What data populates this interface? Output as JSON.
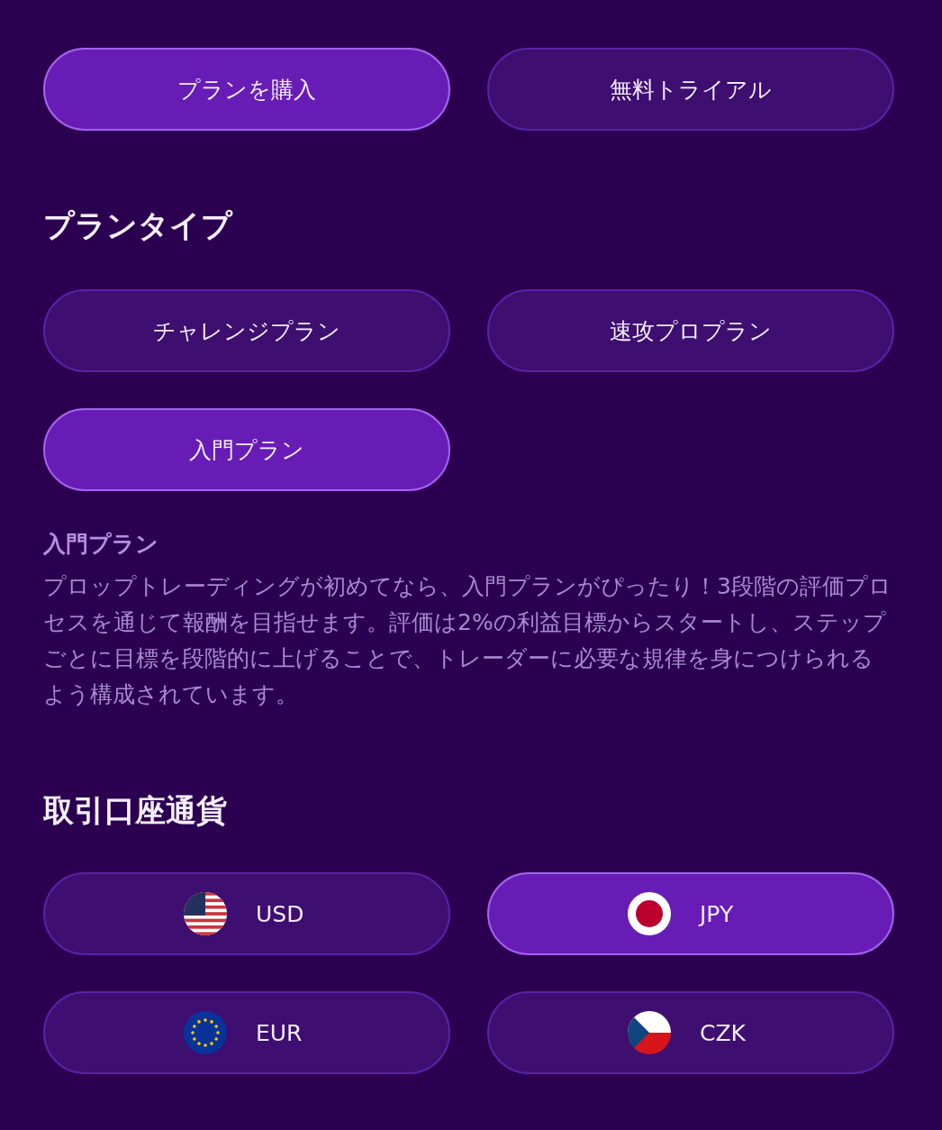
{
  "actions": [
    {
      "label": "プランを購入",
      "selected": true
    },
    {
      "label": "無料トライアル",
      "selected": false
    }
  ],
  "plan_type": {
    "heading": "プランタイプ",
    "options": [
      {
        "label": "チャレンジプラン",
        "selected": false
      },
      {
        "label": "速攻プロプラン",
        "selected": false
      },
      {
        "label": "入門プラン",
        "selected": true
      }
    ],
    "description": {
      "title": "入門プラン",
      "text": "プロップトレーディングが初めてなら、入門プランがぴったり！3段階の評価プロセスを通じて報酬を目指せます。評価は2%の利益目標からスタートし、ステップごとに目標を段階的に上げることで、トレーダーに必要な規律を身につけられるよう構成されています。"
    }
  },
  "currency": {
    "heading": "取引口座通貨",
    "options": [
      {
        "label": "USD",
        "kind": "us",
        "selected": false
      },
      {
        "label": "JPY",
        "kind": "jp",
        "selected": true
      },
      {
        "label": "EUR",
        "kind": "eu",
        "selected": false
      },
      {
        "label": "CZK",
        "kind": "cz",
        "selected": false
      }
    ]
  }
}
